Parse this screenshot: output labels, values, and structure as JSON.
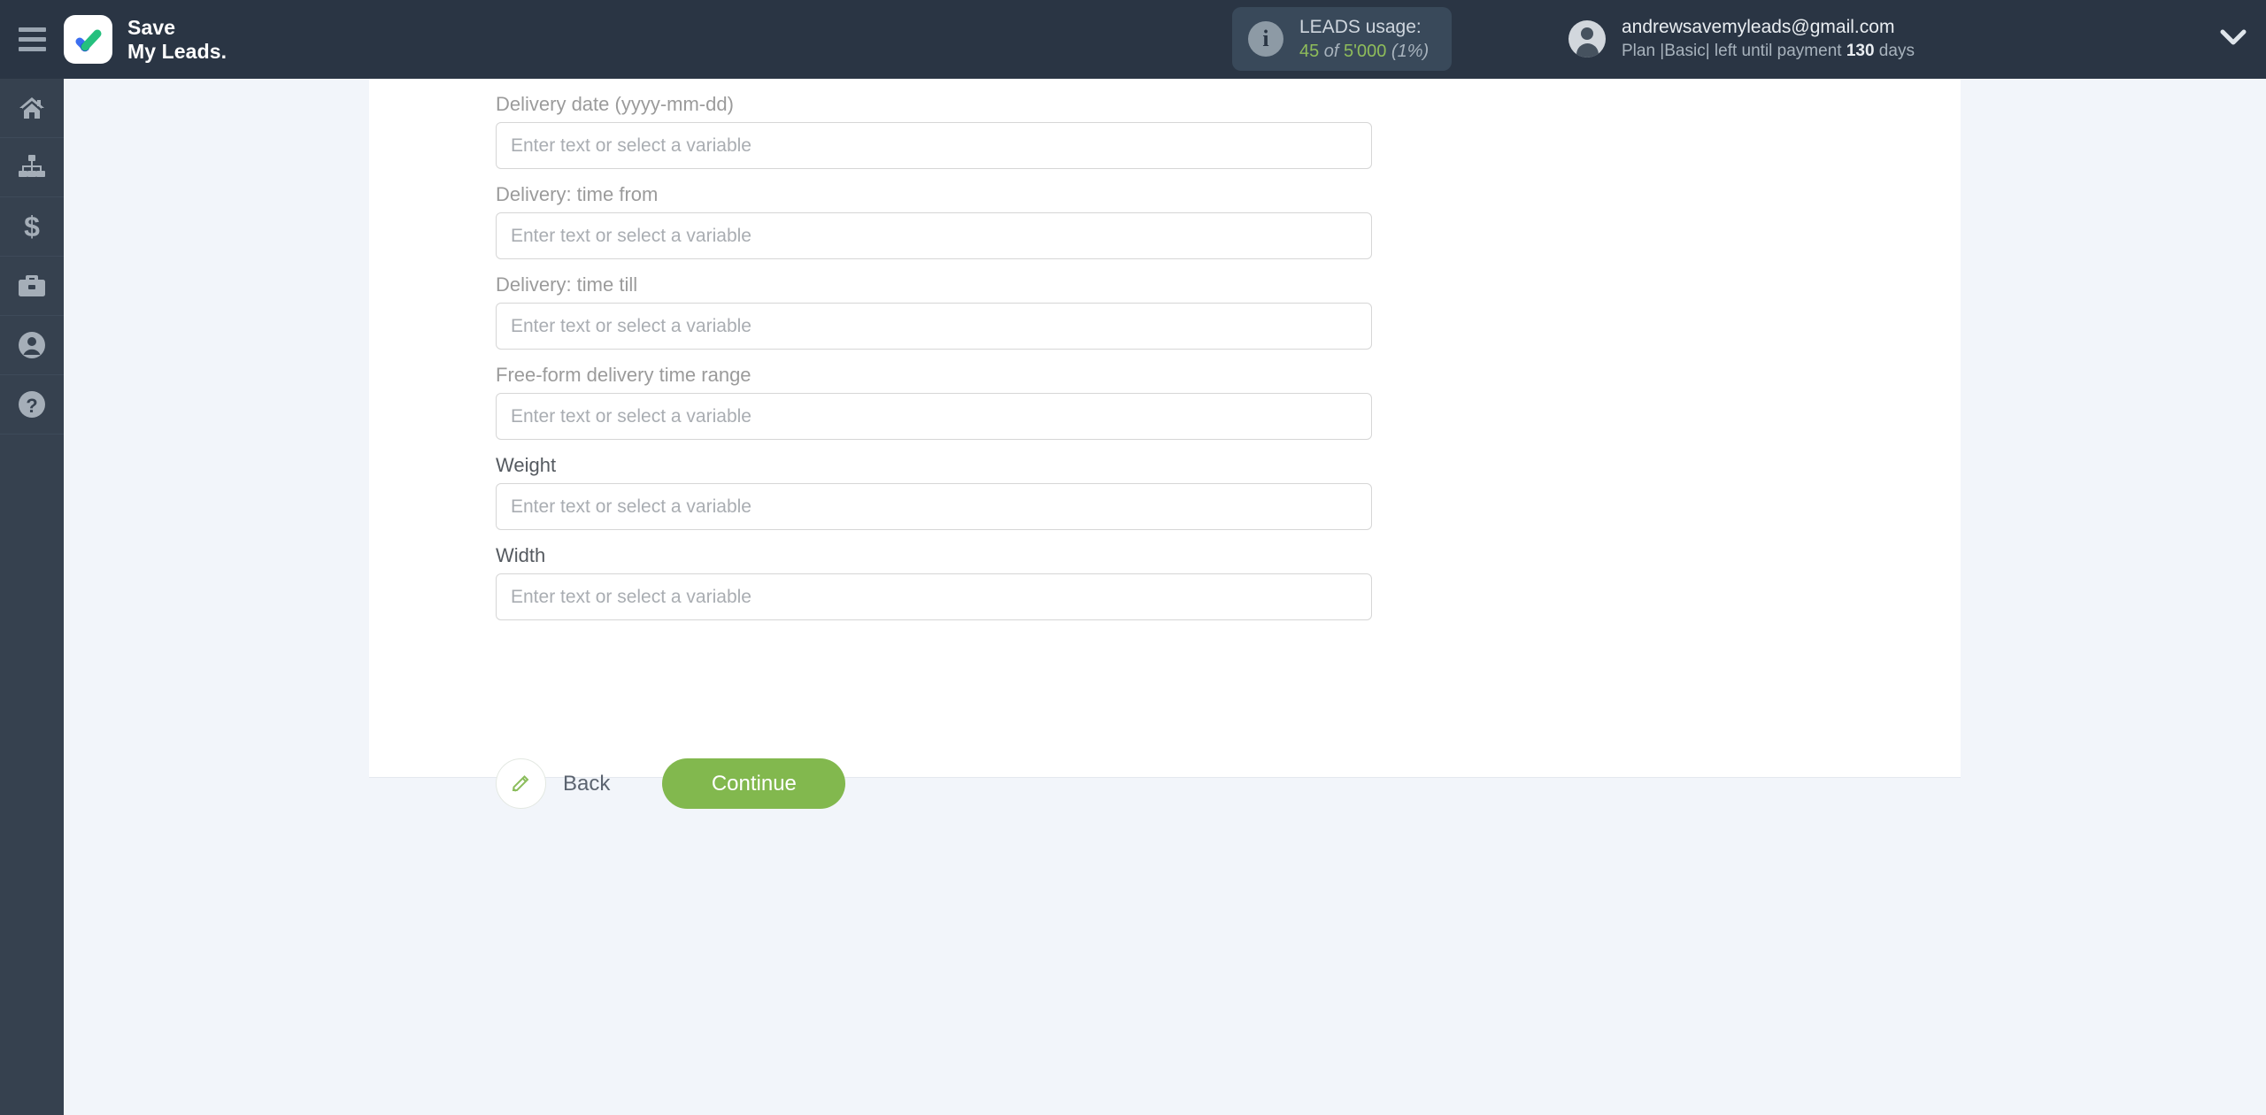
{
  "header": {
    "menu_icon": "hamburger-icon",
    "brand_line1": "Save",
    "brand_line2": "My Leads.",
    "logo_icon": "checkmark-logo-icon",
    "leads": {
      "info_icon": "info-icon",
      "title": "LEADS usage:",
      "used": "45",
      "of": " of ",
      "total": "5'000",
      "percent": " (1%)"
    },
    "account": {
      "avatar_icon": "user-avatar-icon",
      "email": "andrewsavemyleads@gmail.com",
      "plan_prefix": "Plan |Basic| left until payment ",
      "plan_days": "130",
      "plan_suffix": " days",
      "dropdown_icon": "chevron-down-icon"
    }
  },
  "sidebar": {
    "items": [
      {
        "name": "home",
        "icon": "home-icon"
      },
      {
        "name": "connections",
        "icon": "sitemap-icon"
      },
      {
        "name": "billing",
        "icon": "dollar-icon"
      },
      {
        "name": "services",
        "icon": "briefcase-icon"
      },
      {
        "name": "profile",
        "icon": "user-icon"
      },
      {
        "name": "help",
        "icon": "question-circle-icon"
      }
    ]
  },
  "form": {
    "placeholder": "Enter text or select a variable",
    "fields": [
      {
        "label": "Delivery date (yyyy-mm-dd)",
        "value": "",
        "strong": false
      },
      {
        "label": "Delivery: time from",
        "value": "",
        "strong": false
      },
      {
        "label": "Delivery: time till",
        "value": "",
        "strong": false
      },
      {
        "label": "Free-form delivery time range",
        "value": "",
        "strong": false
      },
      {
        "label": "Weight",
        "value": "",
        "strong": true
      },
      {
        "label": "Width",
        "value": "",
        "strong": true
      }
    ]
  },
  "actions": {
    "back_label": "Back",
    "back_icon": "pencil-icon",
    "continue_label": "Continue"
  },
  "colors": {
    "header_bg": "#2a3544",
    "sidebar_bg": "#36414f",
    "page_bg": "#f2f5fa",
    "accent_green": "#82b84e",
    "leads_green": "#8fbd5a"
  }
}
